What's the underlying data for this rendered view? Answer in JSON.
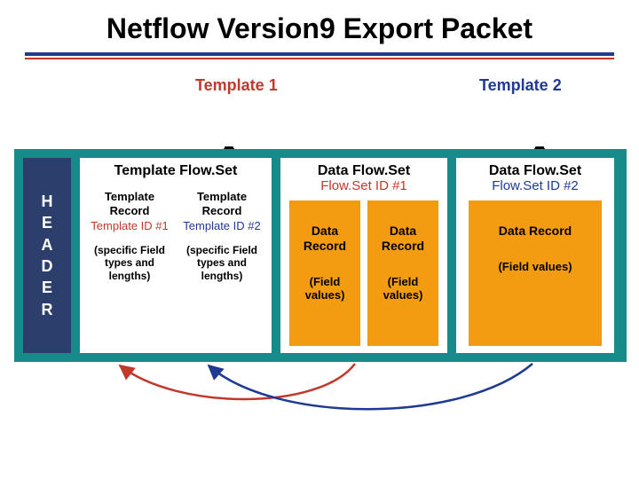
{
  "title": "Netflow Version9 Export Packet",
  "top_labels": {
    "t1": "Template 1",
    "t2": "Template 2"
  },
  "header_letters": [
    "H",
    "E",
    "A",
    "D",
    "E",
    "R"
  ],
  "template_flowset": {
    "title": "Template Flow.Set",
    "records": [
      {
        "head": "Template Record",
        "id_label": "Template ID #1",
        "fields": "(specific Field types and lengths)"
      },
      {
        "head": "Template Record",
        "id_label": "Template ID #2",
        "fields": "(specific Field types and lengths)"
      }
    ]
  },
  "data_flowset_1": {
    "title": "Data Flow.Set",
    "sub": "Flow.Set ID #1",
    "records": [
      {
        "head": "Data Record",
        "fields": "(Field values)"
      },
      {
        "head": "Data Record",
        "fields": "(Field values)"
      }
    ]
  },
  "data_flowset_2": {
    "title": "Data Flow.Set",
    "sub": "Flow.Set ID #2",
    "records": [
      {
        "head": "Data Record",
        "fields": "(Field values)"
      }
    ]
  }
}
